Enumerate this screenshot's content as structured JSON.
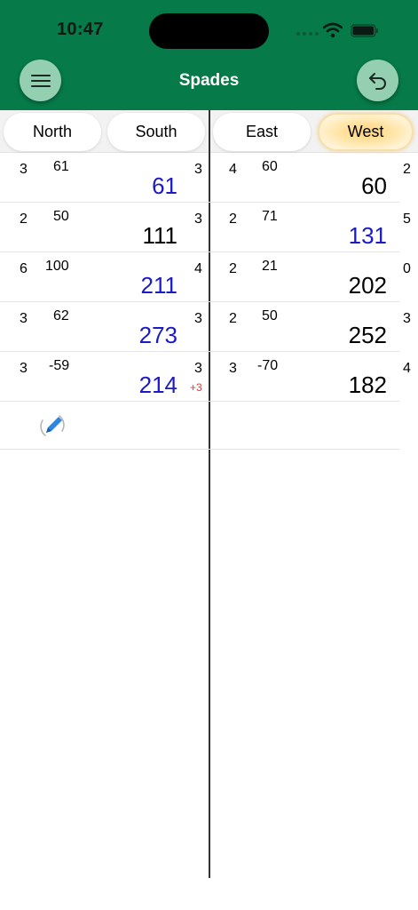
{
  "status": {
    "time": "10:47"
  },
  "nav": {
    "title": "Spades",
    "menu_icon": "hamburger-menu-icon",
    "undo_icon": "undo-arrow-icon"
  },
  "tabs": [
    {
      "label": "North"
    },
    {
      "label": "South"
    },
    {
      "label": "East"
    },
    {
      "label": "West",
      "selected": true
    }
  ],
  "colors": {
    "header": "#067a48",
    "button": "#93cfb0",
    "blue_total": "#1a1ac8",
    "penalty": "#e23b3b",
    "selected_tab": "#ffd37a"
  },
  "team1_rows": [
    {
      "bid": "3",
      "points": "61",
      "total": "61",
      "bags": "3",
      "penalty": ""
    },
    {
      "bid": "2",
      "points": "50",
      "total": "111",
      "bags": "3",
      "penalty": ""
    },
    {
      "bid": "6",
      "points": "100",
      "total": "211",
      "bags": "4",
      "penalty": ""
    },
    {
      "bid": "3",
      "points": "62",
      "total": "273",
      "bags": "3",
      "penalty": ""
    },
    {
      "bid": "3",
      "points": "-59",
      "total": "214",
      "bags": "3",
      "penalty": "+3"
    }
  ],
  "team2_rows": [
    {
      "bid": "4",
      "points": "60",
      "total": "60",
      "bags": "2"
    },
    {
      "bid": "2",
      "points": "71",
      "total": "131",
      "bags": "5"
    },
    {
      "bid": "2",
      "points": "21",
      "total": "202",
      "bags": "0"
    },
    {
      "bid": "2",
      "points": "50",
      "total": "252",
      "bags": "3"
    },
    {
      "bid": "3",
      "points": "-70",
      "total": "182",
      "bags": "4"
    }
  ],
  "edit": {
    "icon": "pencil-edit-icon"
  }
}
